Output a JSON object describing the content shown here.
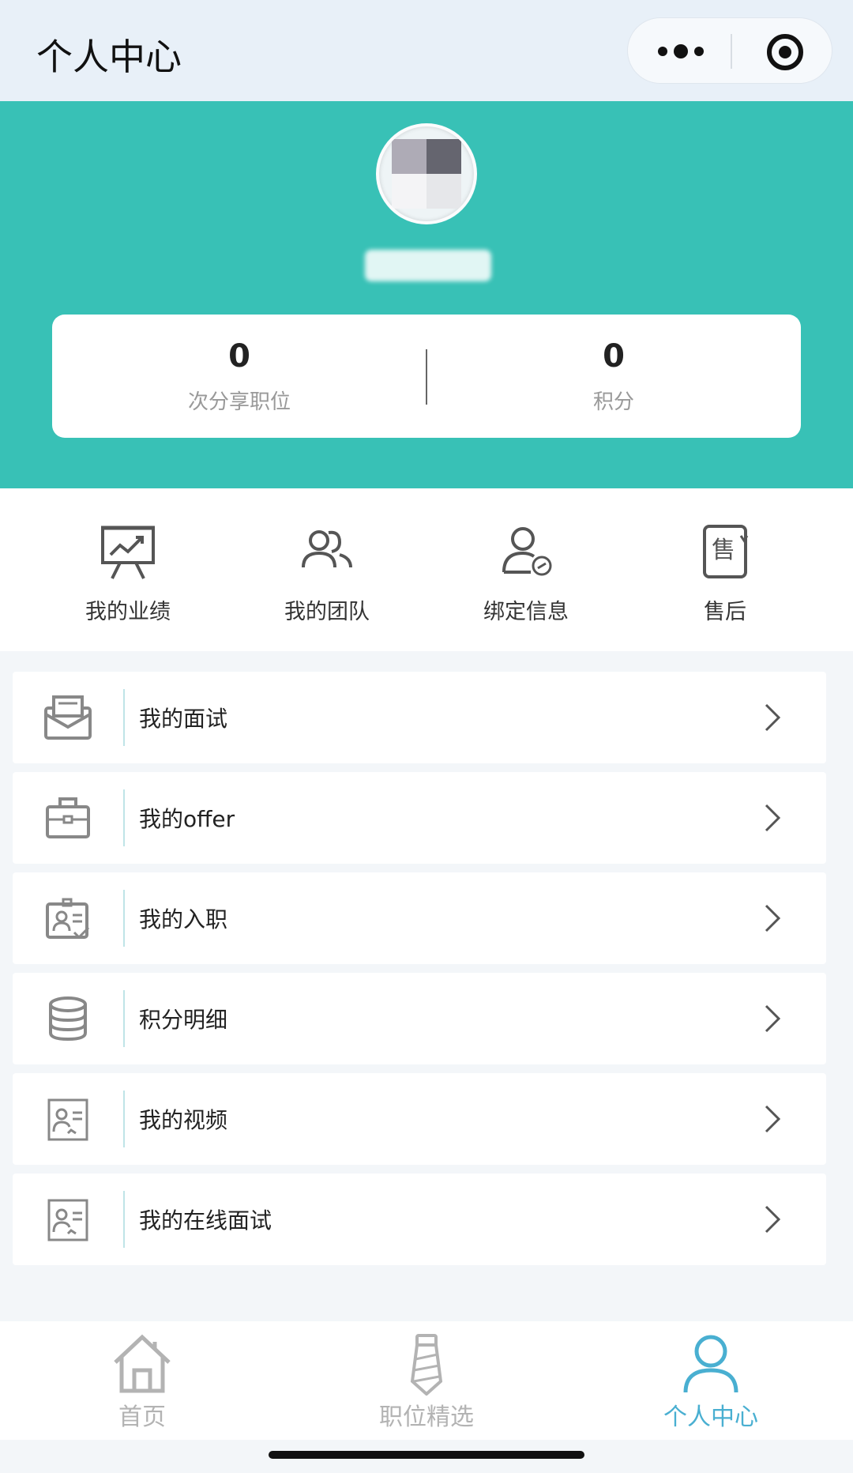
{
  "topbar": {
    "title": "个人中心",
    "more_icon": "more-dots-icon",
    "target_icon": "target-icon"
  },
  "profile": {
    "avatar_icon": "avatar-image",
    "stats": [
      {
        "value": "0",
        "label": "次分享职位"
      },
      {
        "value": "0",
        "label": "积分"
      }
    ]
  },
  "quick_actions": [
    {
      "label": "我的业绩",
      "icon": "presentation-chart-icon"
    },
    {
      "label": "我的团队",
      "icon": "team-icon"
    },
    {
      "label": "绑定信息",
      "icon": "user-link-icon"
    },
    {
      "label": "售后",
      "icon": "after-sales-icon"
    }
  ],
  "menu": [
    {
      "label": "我的面试",
      "icon": "envelope-icon"
    },
    {
      "label": "我的offer",
      "icon": "briefcase-icon"
    },
    {
      "label": "我的入职",
      "icon": "id-card-check-icon"
    },
    {
      "label": "积分明细",
      "icon": "database-icon"
    },
    {
      "label": "我的视频",
      "icon": "profile-card-icon"
    },
    {
      "label": "我的在线面试",
      "icon": "profile-card-icon"
    }
  ],
  "tabbar": [
    {
      "label": "首页",
      "icon": "home-icon",
      "active": false
    },
    {
      "label": "职位精选",
      "icon": "tie-icon",
      "active": false
    },
    {
      "label": "个人中心",
      "icon": "user-icon",
      "active": true
    }
  ],
  "colors": {
    "header_teal": "#38c1b6",
    "active_tab": "#49afd1",
    "topbar_bg": "#e8f0f8"
  }
}
